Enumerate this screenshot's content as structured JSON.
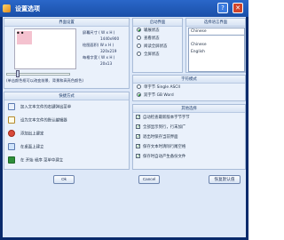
{
  "window": {
    "title": "设置选项"
  },
  "display": {
    "header": "界面设置",
    "rows": [
      {
        "label": "屏幕尺寸 ( W x H )",
        "value": ""
      },
      {
        "label": "",
        "value": "1440x900"
      },
      {
        "label": "绘图面积( W x H )",
        "value": ""
      },
      {
        "label": "",
        "value": "320x219"
      },
      {
        "label": "每格字宽 ( W x H )",
        "value": ""
      },
      {
        "label": "",
        "value": "20x13"
      }
    ],
    "note": "(单击颜色框可以改变前景、背景和高亮色颜色)"
  },
  "startup": {
    "header": "启动界面",
    "options": [
      "输展状态",
      "查看状态",
      "阅读全屏状态",
      "全屏状态"
    ],
    "selected": 0
  },
  "language": {
    "header": "选择语言界面",
    "selected": "Chinese",
    "items": [
      "Chinese",
      "English"
    ]
  },
  "shortcuts": {
    "header": "快捷方式",
    "items": [
      "加入文本文件的右键弹出菜单",
      "设为文本文件的默认编辑器",
      "添加出上键定",
      "在桌面上建立",
      "在 开始 程序 菜单中建立"
    ]
  },
  "char_mode": {
    "header": "字符模式",
    "options": [
      "单字节 Single ASCII",
      "双字节 GB Word"
    ],
    "selected": 1
  },
  "other": {
    "header": "其他选择",
    "items": [
      "自动检查最新版本字节字节",
      "全部显示到行，行末加广",
      "退出时保存当前界面",
      "保存文本时清除行尾空格",
      "保存时自动产生备份文件"
    ],
    "checked": [
      true,
      true,
      true,
      true,
      true
    ]
  },
  "buttons": {
    "ok": "Ok",
    "cancel": "Cancel",
    "defaults": "恢复默认值"
  },
  "colors": {
    "title_bar": "#1a4fa8",
    "client": "#dde8f8",
    "panel": "#eaf1fb",
    "preview_highlight": "#f4c2cf"
  }
}
